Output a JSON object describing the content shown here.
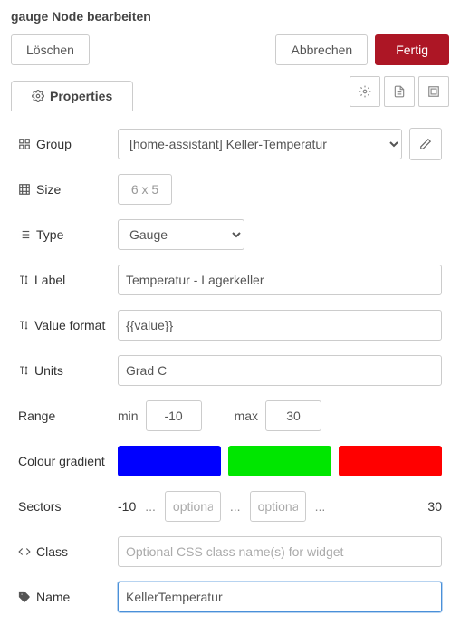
{
  "header": {
    "title": "gauge Node bearbeiten"
  },
  "buttons": {
    "delete": "Löschen",
    "cancel": "Abbrechen",
    "done": "Fertig"
  },
  "tabs": {
    "properties": "Properties"
  },
  "labels": {
    "group": "Group",
    "size": "Size",
    "type": "Type",
    "label": "Label",
    "value_format": "Value format",
    "units": "Units",
    "range": "Range",
    "colour_gradient": "Colour gradient",
    "sectors": "Sectors",
    "class": "Class",
    "name": "Name"
  },
  "fields": {
    "group": "[home-assistant] Keller-Temperatur",
    "size": "6 x 5",
    "type": "Gauge",
    "label": "Temperatur - Lagerkeller",
    "value_format": "{{value}}",
    "units": "Grad C",
    "range_min_label": "min",
    "range_min": "-10",
    "range_max_label": "max",
    "range_max": "30",
    "sectors_start": "-10",
    "sectors_end": "30",
    "sector_placeholder": "optional",
    "class_placeholder": "Optional CSS class name(s) for widget",
    "name": "KellerTemperatur"
  },
  "colors": {
    "gradient": [
      "#0000ff",
      "#00e600",
      "#ff0000"
    ]
  }
}
